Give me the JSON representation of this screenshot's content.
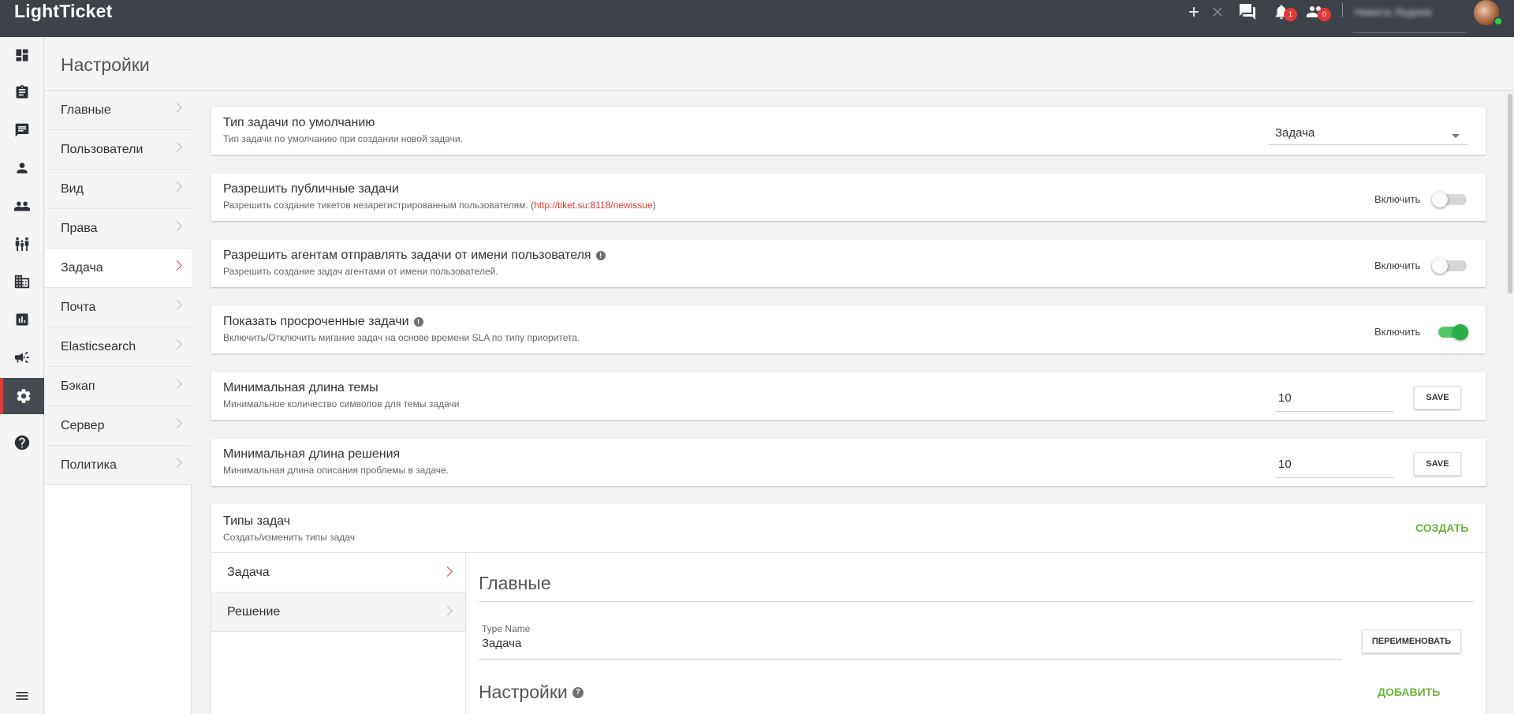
{
  "app": {
    "logo": "LightTicket",
    "user_name": "Никита Леднев"
  },
  "topbar": {
    "notifications_count": "1",
    "users_count": "0"
  },
  "page": {
    "title": "Настройки"
  },
  "menu": {
    "items": [
      {
        "label": "Главные"
      },
      {
        "label": "Пользователи"
      },
      {
        "label": "Вид"
      },
      {
        "label": "Права"
      },
      {
        "label": "Задача",
        "active": true
      },
      {
        "label": "Почта"
      },
      {
        "label": "Elasticsearch"
      },
      {
        "label": "Бэкап"
      },
      {
        "label": "Сервер"
      },
      {
        "label": "Политика"
      }
    ]
  },
  "settings": {
    "default_type": {
      "title": "Тип задачи по умолчанию",
      "subtitle": "Тип задачи по умолчанию при создании новой задачи.",
      "value": "Задача"
    },
    "public_tasks": {
      "title": "Разрешить публичные задачи",
      "subtitle_prefix": "Разрешить создание тикетов незарегистрированным пользователям. (",
      "link": "http://tiket.su:8118/newissue",
      "subtitle_suffix": ")",
      "toggle_label": "Включить",
      "enabled": false
    },
    "agent_on_behalf": {
      "title": "Разрешить агентам отправлять задачи от имени пользователя",
      "subtitle": "Разрешить создание задач агентами от имени пользователей.",
      "toggle_label": "Включить",
      "enabled": false
    },
    "overdue": {
      "title": "Показать просроченные задачи",
      "subtitle": "Включить/Отключить мигание задач на основе времени SLA по типу приоритета.",
      "toggle_label": "Включить",
      "enabled": true
    },
    "min_subject": {
      "title": "Минимальная длина темы",
      "subtitle": "Минимальное количество символов для темы задачи",
      "value": "10",
      "save_label": "SAVE"
    },
    "min_solution": {
      "title": "Минимальная длина решения",
      "subtitle": "Минимальная длина описания проблемы в задаче.",
      "value": "10",
      "save_label": "SAVE"
    }
  },
  "task_types": {
    "title": "Типы задач",
    "subtitle": "Создать/изменить типы задач",
    "create_label": "СОЗДАТЬ",
    "items": [
      {
        "label": "Задача",
        "active": true
      },
      {
        "label": "Решение"
      }
    ],
    "detail": {
      "general_title": "Главные",
      "type_name_label": "Type Name",
      "type_name_value": "Задача",
      "rename_label": "ПЕРЕИМЕНОВАТЬ",
      "settings_title": "Настройки",
      "add_label": "ДОБАВИТЬ"
    }
  }
}
